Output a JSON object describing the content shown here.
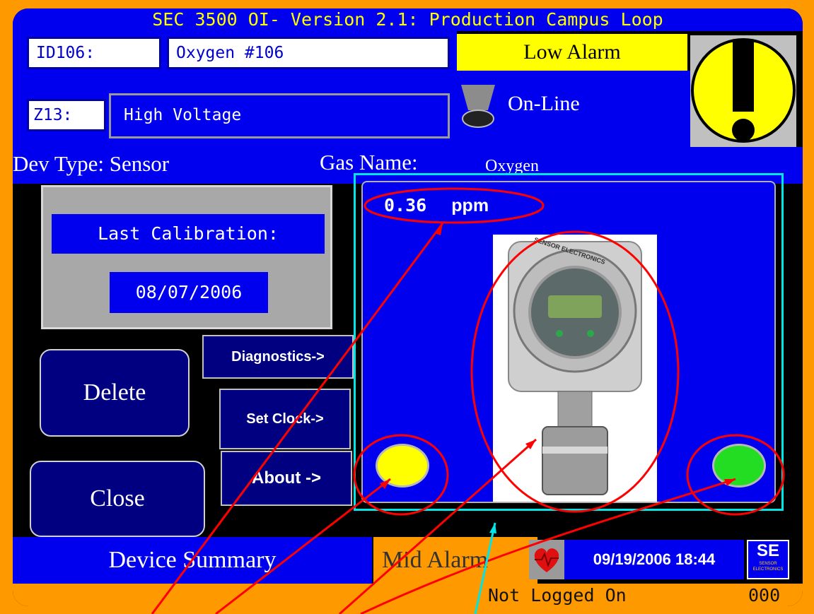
{
  "title": "SEC 3500 OI- Version 2.1: Production Campus Loop",
  "device": {
    "id_label": "ID106:",
    "name": "Oxygen #106",
    "zone_label": "Z13:",
    "zone_name": "High Voltage",
    "alarm_state": "Low Alarm",
    "connection": "On-Line",
    "dev_type_label": "Dev Type: Sensor",
    "gas_name_label": "Gas Name:",
    "gas_name": "Oxygen"
  },
  "calibration": {
    "label": "Last Calibration:",
    "date": "08/07/2006"
  },
  "buttons": {
    "delete": "Delete",
    "close": "Close",
    "diagnostics": "Diagnostics->",
    "set_clock": "Set Clock->",
    "about": "About ->"
  },
  "reading": {
    "value": "0.36",
    "unit": "ppm"
  },
  "status_bar": {
    "screen_name": "Device Summary",
    "alarm": "Mid Alarm",
    "datetime": "09/19/2006 18:44",
    "login": "Not Logged On",
    "code": "000",
    "logo_text": "SE",
    "logo_sub": "SENSOR ELECTRONICS"
  },
  "photo": {
    "brand_text": "SENSOR ELECTRONICS"
  },
  "colors": {
    "frame": "#ff9900",
    "screen_blue": "#0000ee",
    "alarm_yellow": "#ffff00",
    "led_yellow": "#ffff00",
    "led_green": "#22dd22",
    "highlight_cyan": "#00e5e5",
    "annotation_red": "#ff0000"
  }
}
